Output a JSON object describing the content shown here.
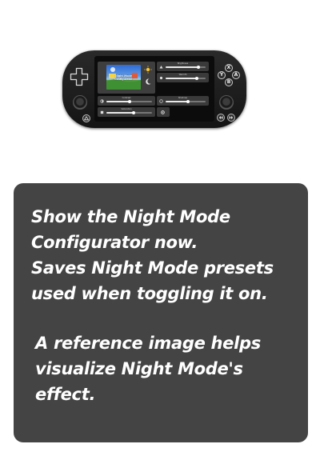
{
  "device": {
    "screen": {
      "preview_title_line1": "Night Mode",
      "preview_title_line2": "Configurator",
      "rows": [
        {
          "label": "Brightness",
          "icon": "brightness-icon",
          "level": 0.82
        },
        {
          "label": "Warmth",
          "icon": "warmth-icon",
          "level": 0.78
        },
        {
          "label": "Contrast",
          "icon": "contrast-icon",
          "level": 0.5
        },
        {
          "label": "Shadows",
          "icon": "shadows-icon",
          "level": 0.55
        },
        {
          "label": "Saturation",
          "icon": "saturation-icon",
          "level": 0.6
        }
      ]
    },
    "buttons": {
      "x": "X",
      "y": "Y",
      "a": "A",
      "b": "B"
    }
  },
  "card": {
    "paragraph1_lines": [
      "Show the Night Mode",
      "Configurator now.",
      "Saves Night Mode presets",
      "used when toggling it on."
    ],
    "paragraph2_lines": [
      "A reference image helps",
      "visualize Night Mode's",
      "effect."
    ]
  },
  "colors": {
    "card_background": "#444444",
    "device_body": "#1c1c1c",
    "text": "#ffffff"
  }
}
